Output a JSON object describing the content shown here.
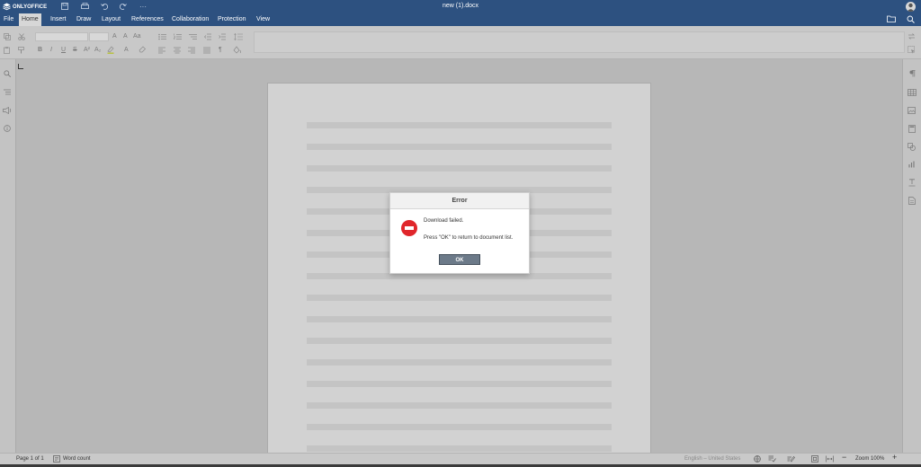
{
  "app": {
    "brand": "ONLYOFFICE",
    "doc_title": "new (1).docx"
  },
  "quick_access": {
    "icons": [
      "save-icon",
      "print-icon",
      "undo-icon",
      "redo-icon",
      "more-icon"
    ],
    "more_label": "···"
  },
  "tabs": [
    {
      "label": "File"
    },
    {
      "label": "Home"
    },
    {
      "label": "Insert"
    },
    {
      "label": "Draw"
    },
    {
      "label": "Layout"
    },
    {
      "label": "References"
    },
    {
      "label": "Collaboration"
    },
    {
      "label": "Protection"
    },
    {
      "label": "View"
    }
  ],
  "toolbar": {
    "format_glyphs": {
      "bold": "B",
      "italic": "I",
      "underline": "U",
      "strikethrough": "S",
      "superscript": "A²",
      "subscript": "A₂",
      "font_color": "A",
      "paragraph": "¶",
      "increase_font": "A",
      "decrease_font": "A",
      "change_case": "Aa"
    }
  },
  "dialog": {
    "title": "Error",
    "message": "Download failed.",
    "detail": "Press \"OK\" to return to document list.",
    "ok_label": "OK",
    "accent": "#e0262b"
  },
  "statusbar": {
    "page_info": "Page 1 of 1",
    "word_count": "Word count",
    "language": "English – United States",
    "zoom": "Zoom 100%",
    "zoom_out": "−",
    "zoom_in": "+"
  },
  "colors": {
    "header_bg": "#2d5180",
    "active_tab_bg": "#d7d7d7",
    "ok_button_bg": "#6c7a89"
  }
}
